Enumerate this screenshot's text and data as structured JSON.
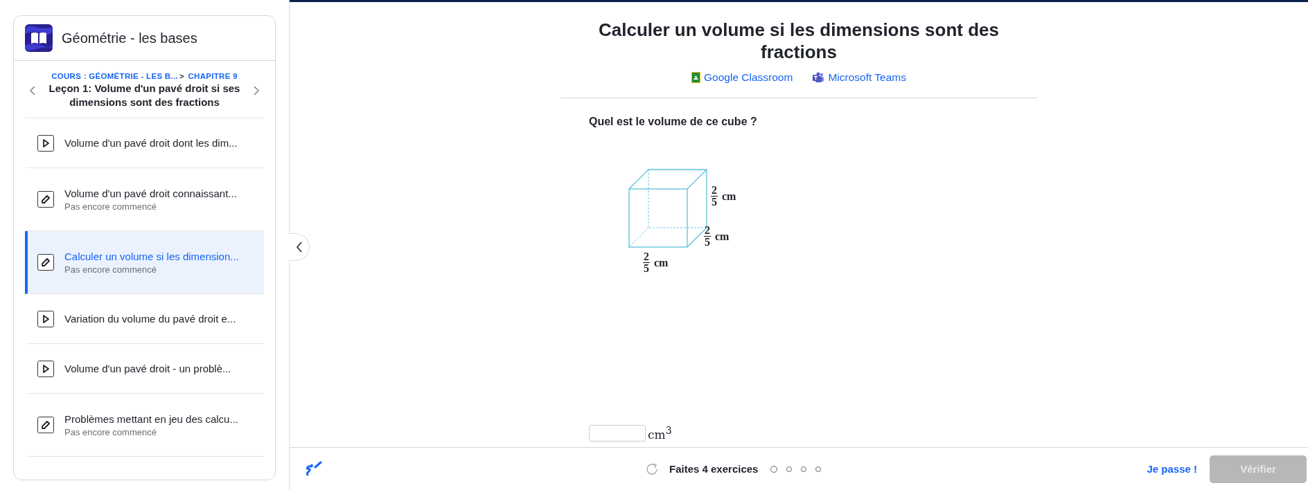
{
  "sidebar": {
    "course_title": "Géométrie - les bases",
    "breadcrumb": {
      "links": [
        "COURS : GÉOMÉTRIE - LES B...",
        "CHAPITRE 9"
      ],
      "separator": ">"
    },
    "lesson_title": "Leçon 1: Volume d'un pavé droit si ses dimensions sont des fractions",
    "items": [
      {
        "kind": "video",
        "title": "Volume d'un pavé droit dont les dim...",
        "selected": false
      },
      {
        "kind": "exercise",
        "title": "Volume d'un pavé droit connaissant...",
        "status": "Pas encore commencé",
        "selected": false
      },
      {
        "kind": "exercise",
        "title": "Calculer un volume si les dimension...",
        "status": "Pas encore commencé",
        "selected": true
      },
      {
        "kind": "video",
        "title": "Variation du volume du pavé droit e...",
        "selected": false
      },
      {
        "kind": "video",
        "title": "Volume d'un pavé droit - un problè...",
        "selected": false
      },
      {
        "kind": "exercise",
        "title": "Problèmes mettant en jeu des calcu...",
        "status": "Pas encore commencé",
        "selected": false
      }
    ]
  },
  "main": {
    "title": "Calculer un volume si les dimensions sont des fractions",
    "share_links": [
      {
        "kind": "classroom",
        "label": "Google Classroom"
      },
      {
        "kind": "teams",
        "label": "Microsoft Teams"
      }
    ],
    "question": "Quel est le volume de ce cube ?",
    "cube_labels": [
      {
        "numerator": "2",
        "denominator": "5",
        "unit": "cm"
      },
      {
        "numerator": "2",
        "denominator": "5",
        "unit": "cm"
      },
      {
        "numerator": "2",
        "denominator": "5",
        "unit": "cm"
      }
    ],
    "answer_unit": "cm$^{3}$"
  },
  "footer": {
    "progress_text": "Faites 4 exercices",
    "exercises": [
      {
        "selected": true
      },
      {
        "selected": false
      },
      {
        "selected": false
      },
      {
        "selected": false
      }
    ],
    "skip_label": "Je passe !",
    "check_label": "Vérifier",
    "check_disabled": true
  }
}
